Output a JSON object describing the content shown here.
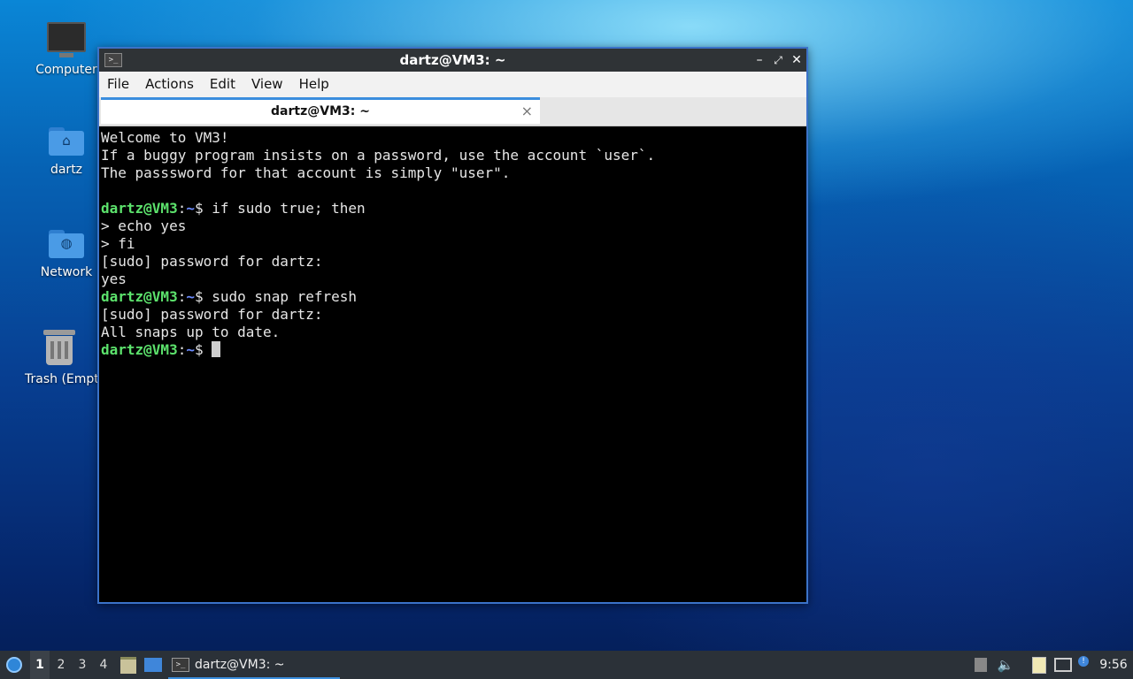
{
  "desktop": {
    "icons": [
      {
        "label": "Computer",
        "icon": "computer-icon"
      },
      {
        "label": "dartz",
        "icon": "home-folder-icon"
      },
      {
        "label": "Network",
        "icon": "network-folder-icon"
      },
      {
        "label": "Trash (Empty)",
        "icon": "trash-icon"
      }
    ]
  },
  "window": {
    "title": "dartz@VM3: ~",
    "menu": [
      "File",
      "Actions",
      "Edit",
      "View",
      "Help"
    ],
    "tab_title": "dartz@VM3: ~",
    "tab_close": "×",
    "controls": {
      "minimize": "–",
      "maximize": "⤢",
      "close": "✕"
    }
  },
  "terminal": {
    "prompt_user": "dartz@VM3",
    "prompt_colon": ":",
    "prompt_path": "~",
    "prompt_dollar": "$",
    "lines": [
      "Welcome to VM3!",
      "If a buggy program insists on a password, use the account `user`.",
      "The passsword for that account is simply \"user\".",
      "",
      " if sudo true; then",
      "> echo yes",
      "> fi",
      "[sudo] password for dartz:",
      "yes",
      " sudo snap refresh",
      "[sudo] password for dartz:",
      "All snaps up to date.",
      " "
    ]
  },
  "taskbar": {
    "workspaces": [
      "1",
      "2",
      "3",
      "4"
    ],
    "active_workspace": "1",
    "task_label": "dartz@VM3: ~",
    "clock": "9:56",
    "tray_icons": [
      "eject-icon",
      "volume-icon",
      "clipboard-icon",
      "network-monitor-icon",
      "notification-icon"
    ]
  },
  "colors": {
    "prompt_user": "#5ce26c",
    "prompt_path": "#6c8cff",
    "accent": "#3b8ede"
  }
}
